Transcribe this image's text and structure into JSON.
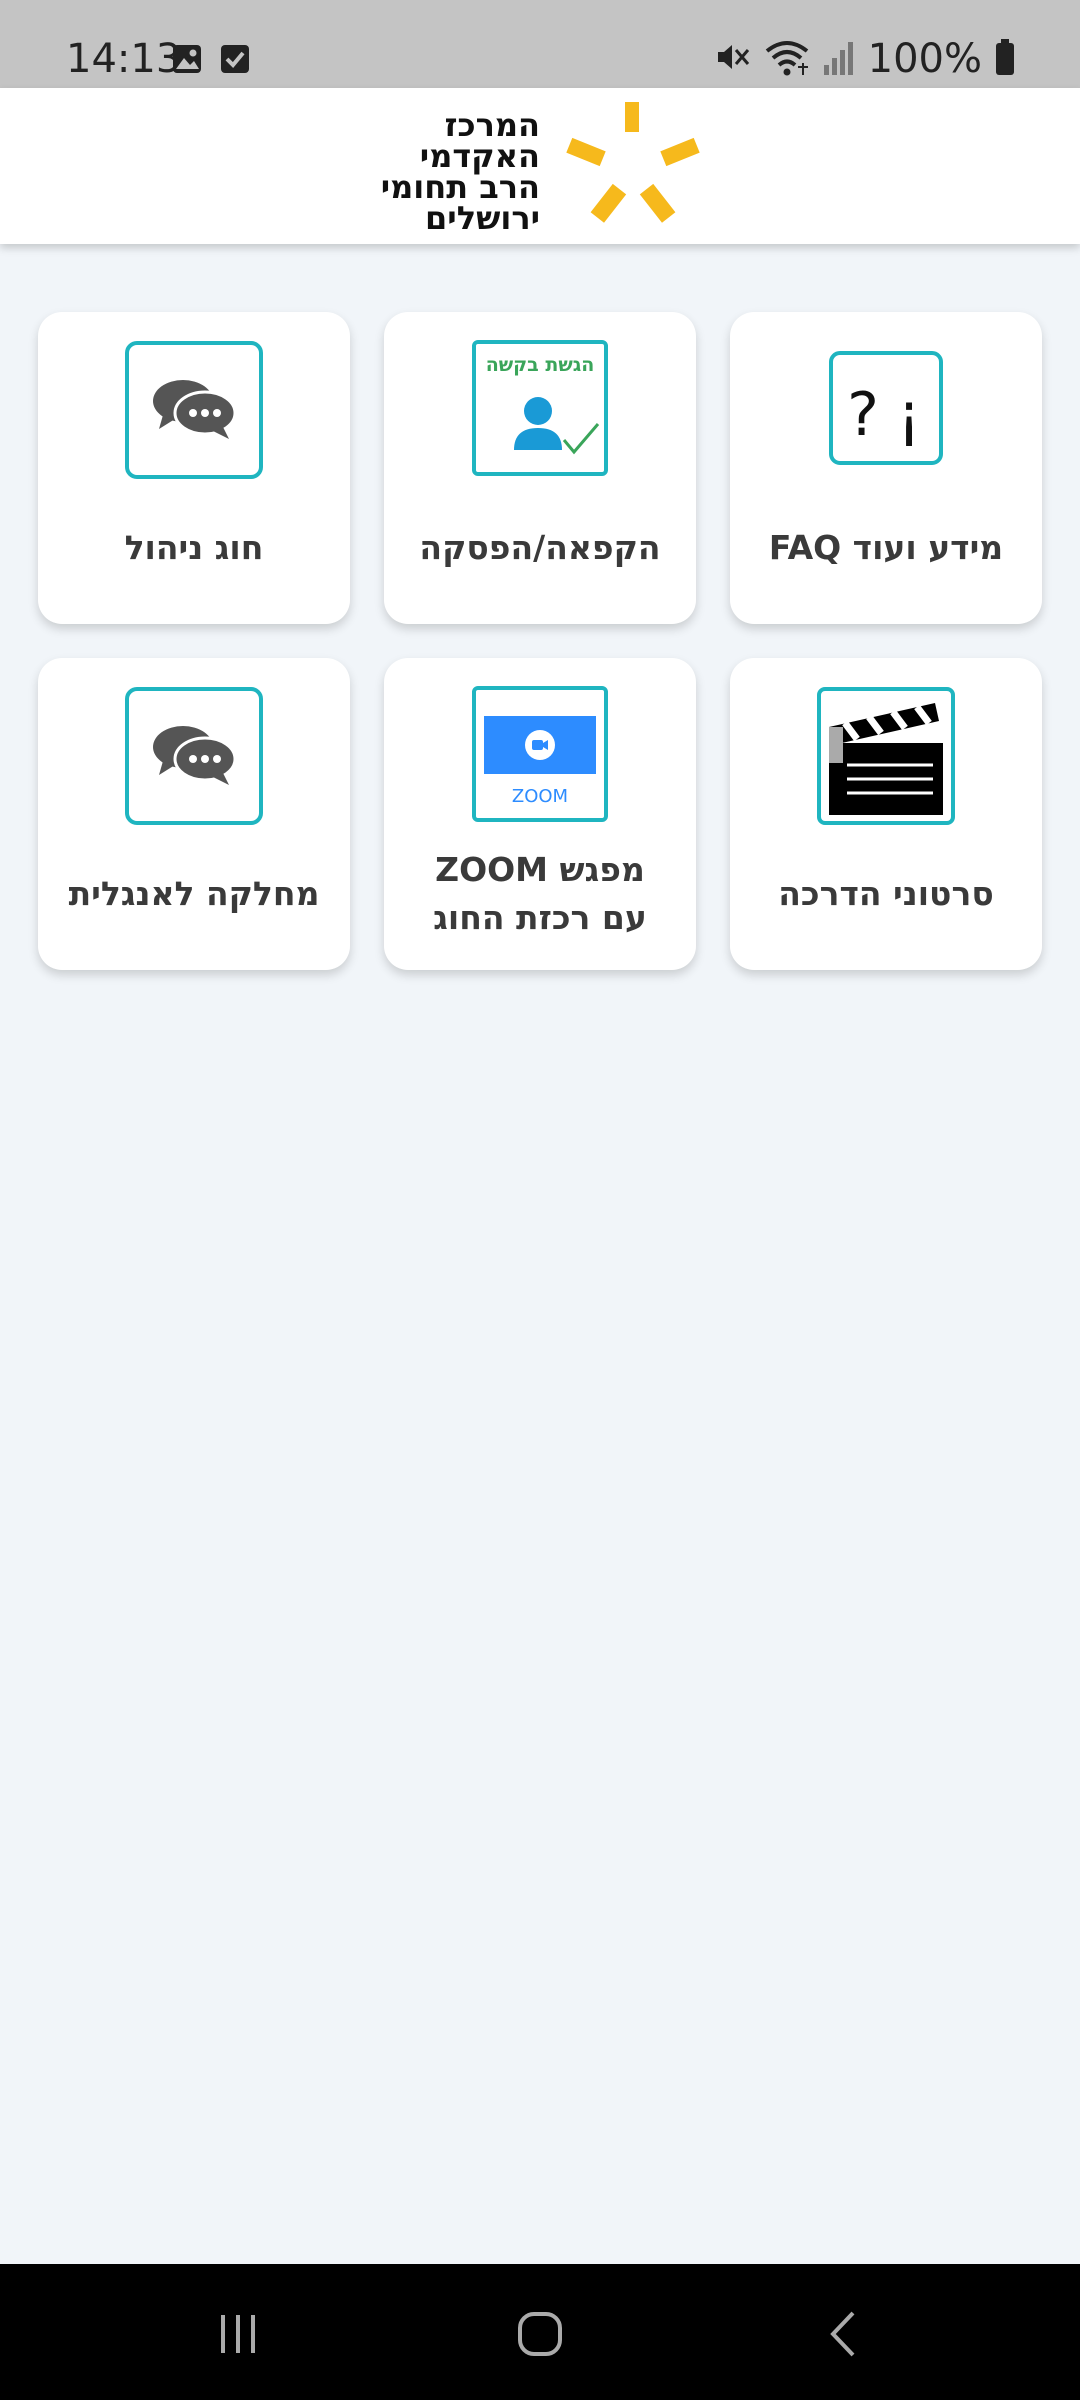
{
  "status_bar": {
    "time": "14:13",
    "battery_percent": "100%",
    "icons": [
      "image-icon",
      "checkbox-icon",
      "mute-icon",
      "wifi-icon",
      "signal-icon",
      "battery-icon"
    ]
  },
  "header": {
    "logo_lines": [
      "המרכז",
      "האקדמי",
      "הרב תחומי",
      "ירושלים"
    ],
    "logo_color": "#f6b91c"
  },
  "tiles": [
    {
      "label": "מידע ועוד FAQ",
      "icon": "info-question-icon"
    },
    {
      "label": "הקפאה/הפסקה",
      "icon": "request-submission-icon",
      "icon_caption": "הגשת בקשה"
    },
    {
      "label": "חוג ניהול",
      "icon": "chat-bubbles-icon"
    },
    {
      "label": "סרטוני הדרכה",
      "icon": "clapperboard-icon"
    },
    {
      "label": "מפגש ZOOM עם רכזת החוג",
      "icon": "zoom-icon",
      "icon_caption": "ZOOM"
    },
    {
      "label": "מחלקה לאנגלית",
      "icon": "chat-bubbles-icon"
    }
  ],
  "colors": {
    "accent_teal": "#1fb5c0",
    "zoom_blue": "#2d8cff",
    "request_green": "#3aa55a",
    "background": "#f1f5f9"
  },
  "nav_bar": {
    "buttons": [
      "recent-apps-icon",
      "home-icon",
      "back-icon"
    ]
  }
}
